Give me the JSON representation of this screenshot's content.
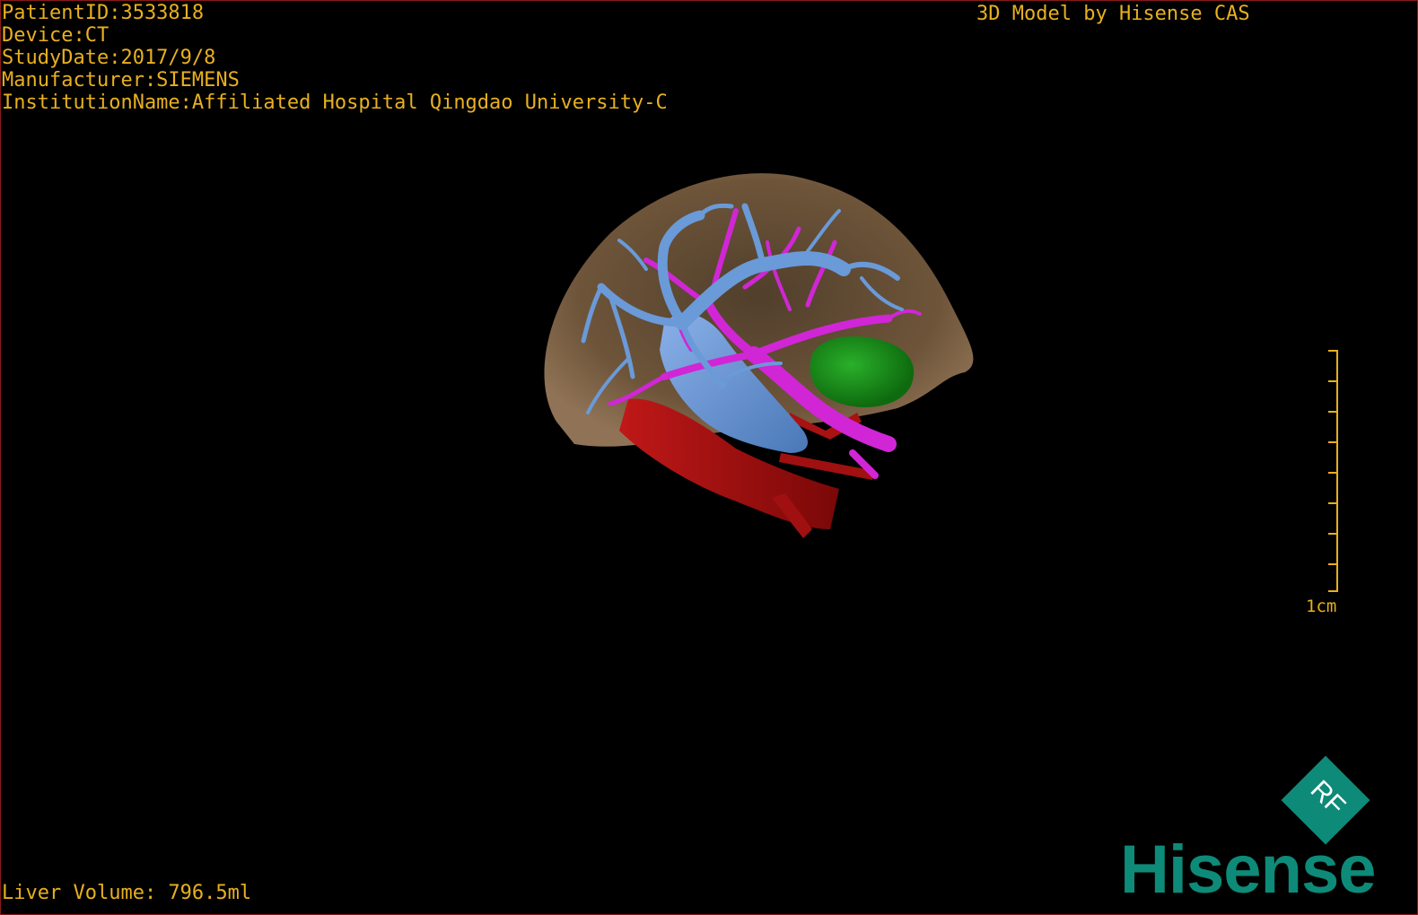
{
  "header": {
    "patient_id": "PatientID:3533818",
    "device": "Device:CT",
    "study_date": "StudyDate:2017/9/8",
    "manufacturer": "Manufacturer:SIEMENS",
    "institution": "InstitutionName:Affiliated Hospital Qingdao University-C"
  },
  "model_title": "3D Model by Hisense CAS",
  "footer": {
    "liver_volume": "Liver Volume: 796.5ml"
  },
  "scale_bar": {
    "label": "1cm",
    "ticks": 9
  },
  "logo": {
    "badge_text": "RF",
    "brand": "Hisense"
  },
  "colors": {
    "text": "#e8b020",
    "liver": "#8a6a48",
    "hepatic_vein": "#6a9ad8",
    "portal_vein": "#d026d6",
    "artery_ivc": "#9a0e0e",
    "lesion": "#1a8a1a",
    "brand": "#0e8a78"
  },
  "icons": [
    "rf-badge-icon",
    "scale-bar-icon"
  ]
}
